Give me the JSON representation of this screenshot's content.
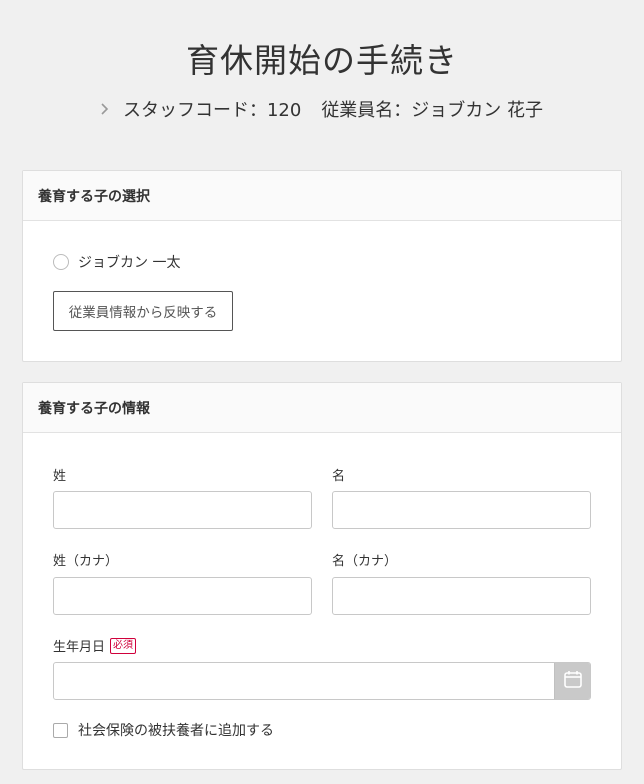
{
  "header": {
    "title": "育休開始の手続き",
    "staff_code": "スタッフコード：120",
    "employee_name": "従業員名：ジョブカン 花子"
  },
  "child_select": {
    "title": "養育する子の選択",
    "children": [
      {
        "label": "ジョブカン 一太",
        "selected": false
      }
    ],
    "reflect_button": "従業員情報から反映する"
  },
  "child_info": {
    "title": "養育する子の情報",
    "last_name_label": "姓",
    "first_name_label": "名",
    "last_name_value": "",
    "first_name_value": "",
    "last_name_kana_label": "姓（カナ）",
    "first_name_kana_label": "名（カナ）",
    "last_name_kana_value": "",
    "first_name_kana_value": "",
    "birthdate_label": "生年月日",
    "required_badge": "必須",
    "birthdate_value": "",
    "dependent_checkbox_label": "社会保険の被扶養者に追加する",
    "dependent_checked": false
  },
  "colors": {
    "background": "#f0f0f0",
    "required": "#d0003b",
    "calendar_button": "#c9c9c9"
  },
  "icons": [
    "chevron-right-icon",
    "calendar-icon"
  ]
}
